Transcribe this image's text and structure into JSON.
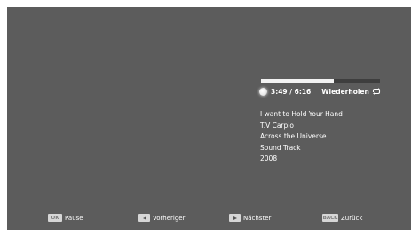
{
  "player": {
    "progress": 0.61,
    "time": "3:49 / 6:16",
    "repeat_label": "Wiederholen",
    "repeat_icon": "repeat-icon"
  },
  "track": {
    "title": "I want to Hold Your Hand",
    "artist": "T.V Carpio",
    "album": "Across the Universe",
    "genre": "Sound Track",
    "year": "2008"
  },
  "footer": {
    "ok_key": "OK",
    "pause_label": "Pause",
    "prev_key_icon": "arrow-left-icon",
    "previous_label": "Vorheriger",
    "next_key_icon": "arrow-right-icon",
    "next_label": "Nächster",
    "back_key": "BACK",
    "back_label": "Zurück"
  }
}
